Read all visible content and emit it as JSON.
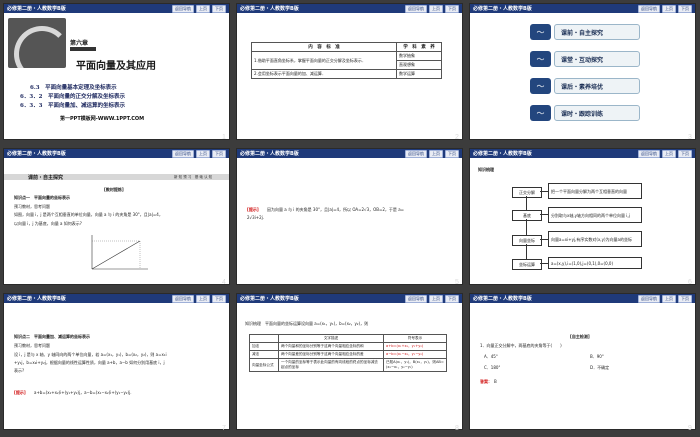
{
  "header": {
    "title": "必修第二册・人教数学B版",
    "btn_nav": "返回导航",
    "btn_prev": "上页",
    "btn_next": "下页"
  },
  "page_numbers": [
    "1",
    "2",
    "3",
    "4",
    "5",
    "6",
    "7",
    "8",
    "9"
  ],
  "slide1": {
    "chapter": "第六章",
    "title": "平面向量及其应用",
    "sections": [
      "6.3　平面向量基本定理及坐标表示",
      "6．3．2　平面向量的正交分解及坐标表示",
      "6．3．3　平面向量加、减运算的坐标表示"
    ],
    "site": "第一PPT模板网-WWW.1PPT.COM"
  },
  "slide2": {
    "headers": [
      "内　容　标　准",
      "学　科　素　养"
    ],
    "rows": [
      [
        "1.借助平面直角坐标系，掌握平面向量的正交分解及坐标表示．",
        "数学抽象"
      ],
      [
        "",
        "直观想象"
      ],
      [
        "2.会用坐标表示平面向量的加、减运算．",
        "数学运算"
      ]
    ]
  },
  "slide3": {
    "items": [
      "课前・自主探究",
      "课堂・互动探究",
      "课后・素养培优",
      "课时・跟踪训练"
    ]
  },
  "slide4": {
    "band_title": "课前・自主探究",
    "band_right": "新 知 预 习　基 础 认 知",
    "label": "[教材提炼]",
    "kp": "知识点一　平面向量的坐标表示",
    "pre": "预习教材，思考问题",
    "q1": "如图，向量 i，j 是两个互相垂直的单位向量，向量 a 与 i 的夹角是 30°，且|a|=4，",
    "q2": "以向量 i，j 为基底，向量 a 如何表示?"
  },
  "slide5": {
    "tip": "[提示]",
    "text": "因为向量 a 与 i 的夹角是 30°，且|a|=4，所以 OA=2√3，OB=2，于是 a=",
    "text2": "2√3i+2j."
  },
  "slide6": {
    "title": "知识梳理",
    "boxes": [
      "正交分解",
      "基底",
      "向量坐标",
      "坐标运算"
    ],
    "desc1": "把一个平面向量分解为两个互相垂直的向量",
    "desc2": "分别取与x轴,y轴方向相同的两个单位向量 i,j",
    "desc3": "向量a=xi+yj,有序实数对(x,y)为向量a的坐标",
    "desc4": "a=(x,y),i=(1,0),j=(0,1),0=(0,0)"
  },
  "slide7": {
    "kp": "知识点二　平面向量加、减运算的坐标表示",
    "pre": "预习教材，思考问题",
    "q1": "设 i，j 是与 x 轴、y 轴同向的两个单位向量，若 a=(x₁，y₁)，b=(x₂，y₂)，则 a=x₁i",
    "q2": "+y₁j，b=x₂i+y₂j，根据向量的线性运算性质，向量 a+b，a−b 如何分别用基底 i，j",
    "q3": "表示?",
    "tip": "[提示]",
    "ans": "a+b=(x₁+x₂)i+(y₁+y₂)j，a−b=(x₁−x₂)i+(y₁−y₂)j."
  },
  "slide8": {
    "intro": "知识梳理　平面向量的坐标运算设向量 a=(x₁，y₁)，b=(x₂，y₂)，则",
    "headers": [
      "",
      "文字描述",
      "符号表示"
    ],
    "rows": [
      [
        "加法",
        "两个向量和的坐标分别等于这两个向量相应坐标的和",
        "a+b=(x₁+x₂，y₁+y₂)"
      ],
      [
        "减法",
        "两个向量差的坐标分别等于这两个向量相应坐标的差",
        "a−b=(x₁−x₂，y₁−y₂)"
      ],
      [
        "向量坐标公式",
        "一个向量的坐标等于表示此向量的有向线段的终点的坐标减去起点的坐标",
        "已知A(x₁，y₁)，B(x₂，y₂)，则AB=(x₂−x₁，y₂−y₁)"
      ]
    ]
  },
  "slide9": {
    "label": "[自主检测]",
    "q": "1．向量正交分解中，两基底的夹角等于(　　)",
    "options": [
      "A．45°",
      "B．90°",
      "C．180°",
      "D．不确定"
    ],
    "answer_label": "答案：",
    "answer": "B"
  }
}
